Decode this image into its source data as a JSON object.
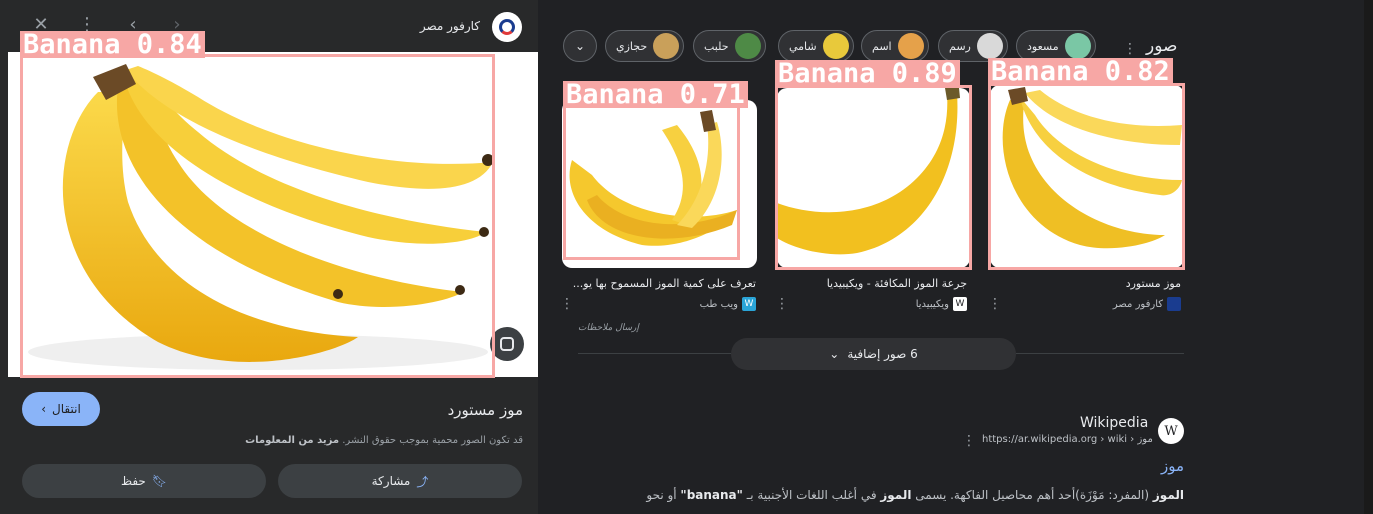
{
  "viewer": {
    "source_name": "كارفور مصر",
    "title": "موز مستورد",
    "visit_label": "انتقال",
    "copyright_note": "قد تكون الصور محمية بموجب حقوق النشر.",
    "learn_more": "مزيد من المعلومات",
    "share_label": "مشاركة",
    "save_label": "حفظ",
    "detection": {
      "label": "Banana 0.84",
      "confidence": 0.84
    }
  },
  "search": {
    "query": "صور",
    "chips": [
      {
        "label": "مسعود",
        "color": "#7ac7a5"
      },
      {
        "label": "رسم",
        "color": "#d9d9d9"
      },
      {
        "label": "اسم",
        "color": "#e5a14a"
      },
      {
        "label": "شامي",
        "color": "#e8c93b"
      },
      {
        "label": "حلبب",
        "color": "#4e8a46"
      },
      {
        "label": "حجازي",
        "color": "#c9a05a"
      }
    ]
  },
  "results": [
    {
      "title": "موز مستورد",
      "source": "كارفور مصر",
      "detection": {
        "label": "Banana 0.82",
        "confidence": 0.82
      }
    },
    {
      "title": "جرعة الموز المكافئة - ويكيبيديا",
      "source": "ويكيبيديا",
      "detection": {
        "label": "Banana 0.89",
        "confidence": 0.89
      }
    },
    {
      "title": "تعرف على كمية الموز المسموح بها يو...",
      "source": "ويب طب",
      "detection": {
        "label": "Banana 0.71",
        "confidence": 0.71
      }
    }
  ],
  "feedback": "إرسال ملاحظات",
  "more_images": "6 صور إضافية",
  "wiki": {
    "name": "Wikipedia",
    "url": "https://ar.wikipedia.org › wiki › موز",
    "title": "موز",
    "snippet_bold1": "الموز",
    "snippet_part1": " (المفرد: مَوْزَة)أحد أهم محاصيل الفاكهة. يسمى ",
    "snippet_bold2": "الموز",
    "snippet_part2": " في أغلب اللغات الأجنبية بـ ",
    "snippet_bold3": "\"banana\"",
    "snippet_part3": " أو نحو"
  },
  "colors": {
    "accent": "#8ab4f8",
    "detection": "#f7a7a5",
    "banana": "#f5c518"
  }
}
